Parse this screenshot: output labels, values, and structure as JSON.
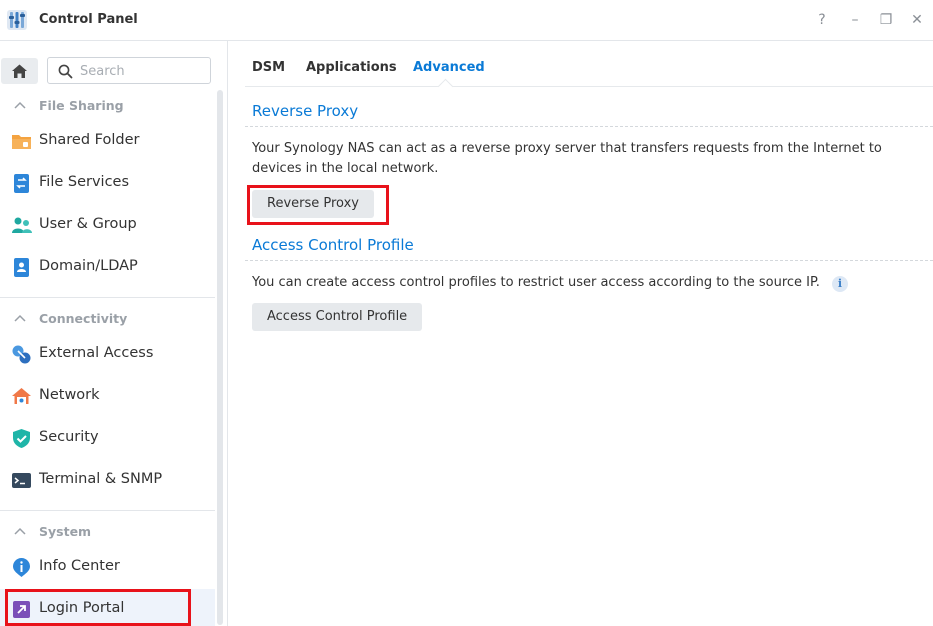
{
  "window": {
    "title": "Control Panel",
    "buttons": {
      "help": "?",
      "minimize": "–",
      "maximize": "❐",
      "close": "✕"
    }
  },
  "sidebar": {
    "search_placeholder": "Search",
    "sections": [
      {
        "label": "File Sharing",
        "items": [
          "Shared Folder",
          "File Services",
          "User & Group",
          "Domain/LDAP"
        ]
      },
      {
        "label": "Connectivity",
        "items": [
          "External Access",
          "Network",
          "Security",
          "Terminal & SNMP"
        ]
      },
      {
        "label": "System",
        "items": [
          "Info Center",
          "Login Portal"
        ]
      }
    ],
    "active_item": "Login Portal"
  },
  "tabs": [
    {
      "label": "DSM",
      "active": false
    },
    {
      "label": "Applications",
      "active": false
    },
    {
      "label": "Advanced",
      "active": true
    }
  ],
  "content": {
    "reverse_proxy": {
      "title": "Reverse Proxy",
      "description": "Your Synology NAS can act as a reverse proxy server that transfers requests from the Internet to devices in the local network.",
      "button": "Reverse Proxy"
    },
    "access_control": {
      "title": "Access Control Profile",
      "description": "You can create access control profiles to restrict user access according to the source IP.",
      "button": "Access Control Profile",
      "info_icon": "i"
    }
  },
  "colors": {
    "accent": "#0a7ad6",
    "highlight": "#e8121a",
    "active_bg": "#eef3fb"
  }
}
